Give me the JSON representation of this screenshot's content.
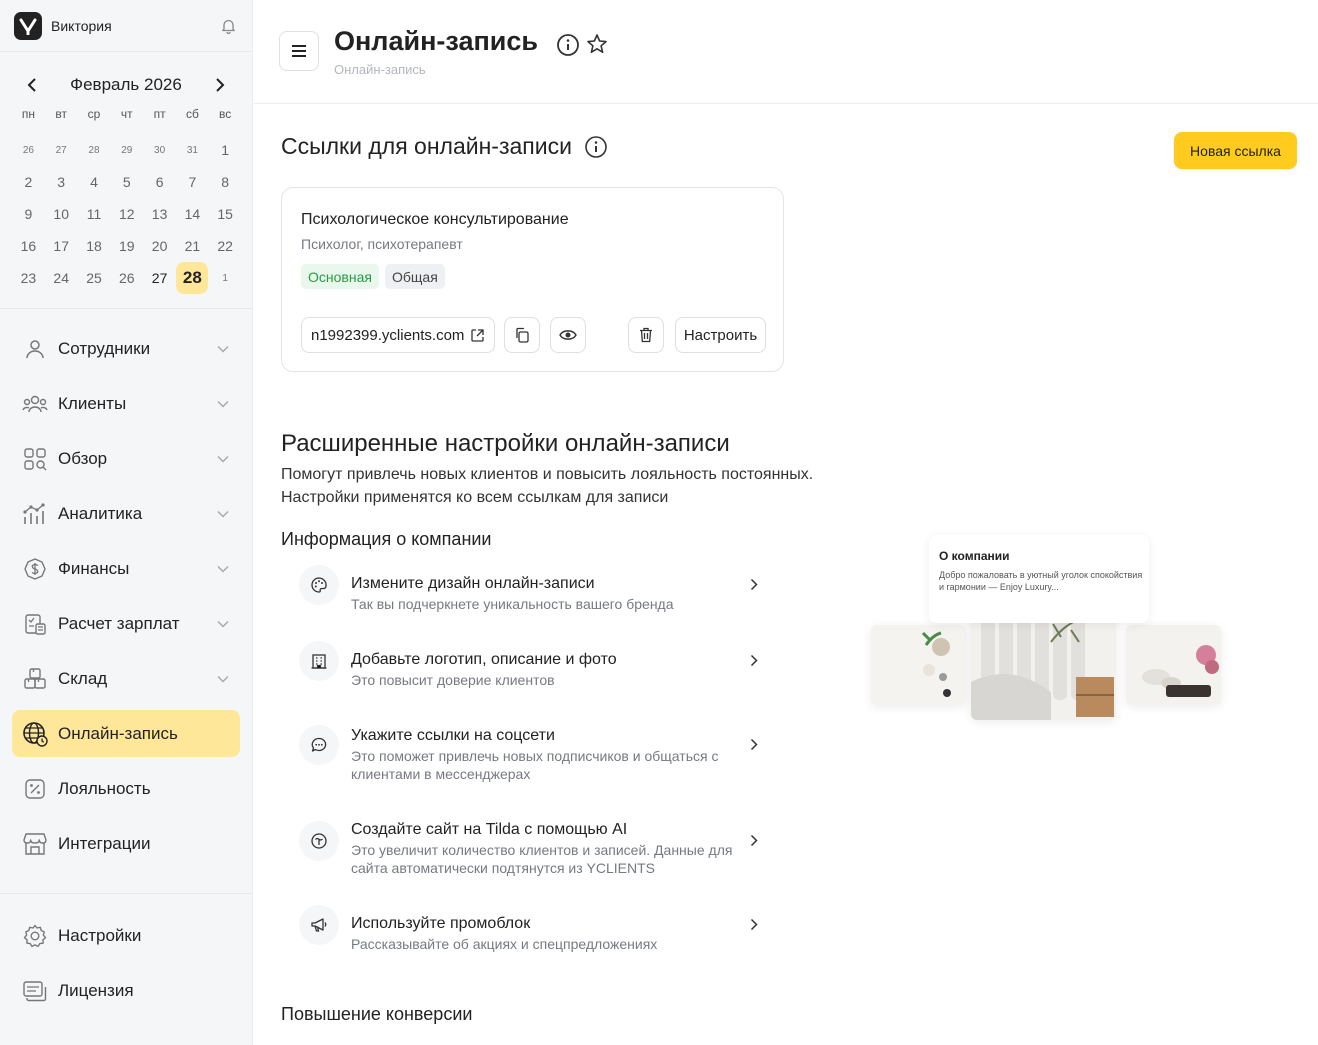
{
  "user": {
    "name": "Виктория"
  },
  "calendar": {
    "month": "Февраль 2026",
    "weekdays": [
      "пн",
      "вт",
      "ср",
      "чт",
      "пт",
      "сб",
      "вс"
    ],
    "weeks": [
      [
        "26",
        "27",
        "28",
        "29",
        "30",
        "31",
        "1"
      ],
      [
        "2",
        "3",
        "4",
        "5",
        "6",
        "7",
        "8"
      ],
      [
        "9",
        "10",
        "11",
        "12",
        "13",
        "14",
        "15"
      ],
      [
        "16",
        "17",
        "18",
        "19",
        "20",
        "21",
        "22"
      ],
      [
        "23",
        "24",
        "25",
        "26",
        "27",
        "28",
        "1"
      ]
    ]
  },
  "menu": [
    {
      "label": "Сотрудники",
      "icon": "user-icon",
      "chevron": true
    },
    {
      "label": "Клиенты",
      "icon": "users-icon",
      "chevron": true
    },
    {
      "label": "Обзор",
      "icon": "grid-search-icon",
      "chevron": true
    },
    {
      "label": "Аналитика",
      "icon": "analytics-icon",
      "chevron": true
    },
    {
      "label": "Финансы",
      "icon": "dollar-icon",
      "chevron": true
    },
    {
      "label": "Расчет зарплат",
      "icon": "payroll-icon",
      "chevron": true
    },
    {
      "label": "Склад",
      "icon": "boxes-icon",
      "chevron": true
    },
    {
      "label": "Онлайн-запись",
      "icon": "globe-icon",
      "chevron": false,
      "active": true
    },
    {
      "label": "Лояльность",
      "icon": "percent-icon",
      "chevron": false
    },
    {
      "label": "Интеграции",
      "icon": "store-icon",
      "chevron": false
    }
  ],
  "menu_bottom": [
    {
      "label": "Настройки",
      "icon": "gear-icon"
    },
    {
      "label": "Лицензия",
      "icon": "license-icon"
    }
  ],
  "header": {
    "title": "Онлайн-запись",
    "breadcrumb": "Онлайн-запись"
  },
  "links_section": {
    "title": "Ссылки для онлайн-записи",
    "new_button": "Новая ссылка",
    "card": {
      "title": "Психологическое консультирование",
      "subtitle": "Психолог, психотерапевт",
      "tag_main": "Основная",
      "tag_common": "Общая",
      "url": "n1992399.yclients.com",
      "setup_button": "Настроить"
    }
  },
  "advanced": {
    "title": "Расширенные настройки онлайн-записи",
    "desc_line1": "Помогут привлечь новых клиентов и повысить лояльность постоянных.",
    "desc_line2": "Настройки применятся ко всем ссылкам для записи",
    "company_title": "Информация о компании",
    "options": [
      {
        "title": "Измените дизайн онлайн-записи",
        "desc": "Так вы подчеркнете уникальность вашего бренда",
        "icon": "palette-icon"
      },
      {
        "title": "Добавьте логотип, описание и фото",
        "desc": "Это повысит доверие клиентов",
        "icon": "building-icon"
      },
      {
        "title": "Укажите ссылки на соцсети",
        "desc": "Это поможет привлечь новых подписчиков и общаться с клиентами в мессенджерах",
        "icon": "chat-icon"
      },
      {
        "title": "Создайте сайт на Tilda с помощью AI",
        "desc": "Это увеличит количество клиентов и записей. Данные для сайта автоматически подтянутся из YCLIENTS",
        "icon": "tilda-icon"
      },
      {
        "title": "Используйте промоблок",
        "desc": "Рассказывайте об акциях и спецпредложениях",
        "icon": "megaphone-icon"
      }
    ],
    "conversion_title": "Повышение конверсии"
  },
  "preview": {
    "title": "О компании",
    "text": "Добро пожаловать в уютный уголок спокойствия и гармонии — Enjoy Luxury..."
  }
}
